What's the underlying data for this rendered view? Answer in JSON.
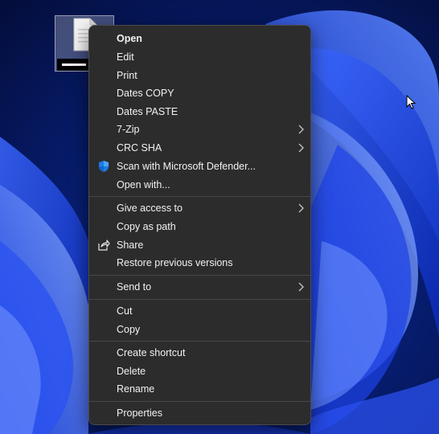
{
  "desktop": {
    "wallpaper": "windows-11-bloom",
    "accent": "#1f3fd8"
  },
  "file_icon": {
    "icon": "document-icon"
  },
  "context_menu": {
    "items": [
      {
        "label": "Open",
        "bold": true
      },
      {
        "label": "Edit"
      },
      {
        "label": "Print"
      },
      {
        "label": "Dates COPY"
      },
      {
        "label": "Dates PASTE"
      },
      {
        "label": "7-Zip",
        "submenu": true
      },
      {
        "label": "CRC SHA",
        "submenu": true
      },
      {
        "label": "Scan with Microsoft Defender...",
        "icon": "defender-shield-icon"
      },
      {
        "label": "Open with..."
      },
      {
        "label": "Give access to",
        "submenu": true
      },
      {
        "label": "Copy as path"
      },
      {
        "label": "Share",
        "icon": "share-icon"
      },
      {
        "label": "Restore previous versions"
      },
      {
        "label": "Send to",
        "submenu": true
      },
      {
        "label": "Cut"
      },
      {
        "label": "Copy"
      },
      {
        "label": "Create shortcut"
      },
      {
        "label": "Delete"
      },
      {
        "label": "Rename"
      },
      {
        "label": "Properties"
      }
    ],
    "colors": {
      "background": "#2c2c2c",
      "text": "#f2f2f2",
      "separator": "#474747"
    }
  }
}
